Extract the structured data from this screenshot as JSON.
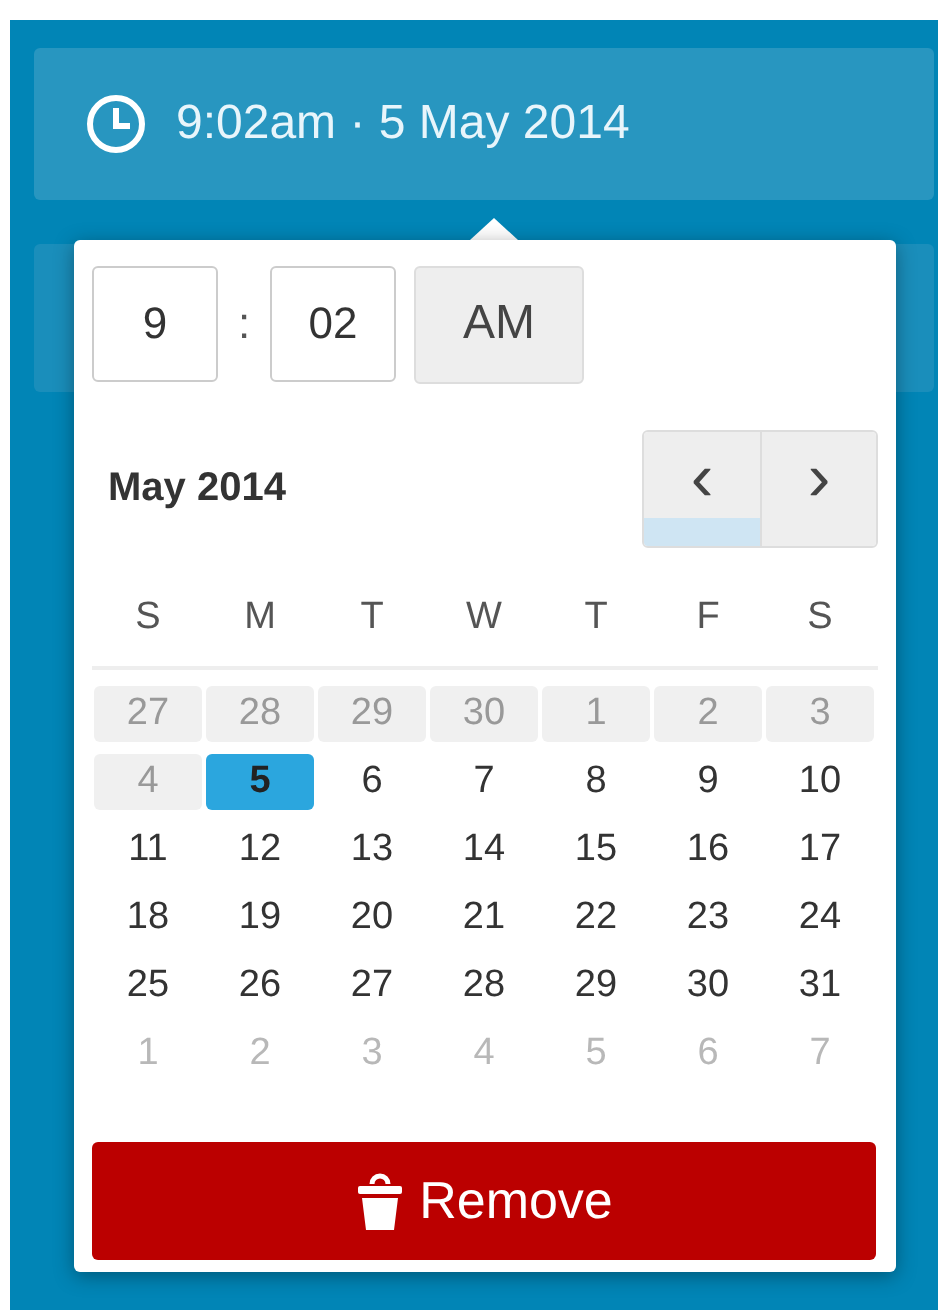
{
  "summary": {
    "text": "9:02am · 5 May 2014"
  },
  "time": {
    "hour": "9",
    "separator": ":",
    "minute": "02",
    "meridiem": "AM"
  },
  "calendar": {
    "title": "May 2014",
    "prev": {
      "label": "‹",
      "focused": true
    },
    "next": {
      "label": "›",
      "focused": false
    },
    "weekdays": [
      "S",
      "M",
      "T",
      "W",
      "T",
      "F",
      "S"
    ],
    "weeks": [
      [
        {
          "label": "27",
          "kind": "disabled",
          "selected": false
        },
        {
          "label": "28",
          "kind": "disabled",
          "selected": false
        },
        {
          "label": "29",
          "kind": "disabled",
          "selected": false
        },
        {
          "label": "30",
          "kind": "disabled",
          "selected": false
        },
        {
          "label": "1",
          "kind": "disabled",
          "selected": false
        },
        {
          "label": "2",
          "kind": "disabled",
          "selected": false
        },
        {
          "label": "3",
          "kind": "disabled",
          "selected": false
        }
      ],
      [
        {
          "label": "4",
          "kind": "disabled",
          "selected": false
        },
        {
          "label": "5",
          "kind": "day",
          "selected": true
        },
        {
          "label": "6",
          "kind": "day",
          "selected": false
        },
        {
          "label": "7",
          "kind": "day",
          "selected": false
        },
        {
          "label": "8",
          "kind": "day",
          "selected": false
        },
        {
          "label": "9",
          "kind": "day",
          "selected": false
        },
        {
          "label": "10",
          "kind": "day",
          "selected": false
        }
      ],
      [
        {
          "label": "11",
          "kind": "day",
          "selected": false
        },
        {
          "label": "12",
          "kind": "day",
          "selected": false
        },
        {
          "label": "13",
          "kind": "day",
          "selected": false
        },
        {
          "label": "14",
          "kind": "day",
          "selected": false
        },
        {
          "label": "15",
          "kind": "day",
          "selected": false
        },
        {
          "label": "16",
          "kind": "day",
          "selected": false
        },
        {
          "label": "17",
          "kind": "day",
          "selected": false
        }
      ],
      [
        {
          "label": "18",
          "kind": "day",
          "selected": false
        },
        {
          "label": "19",
          "kind": "day",
          "selected": false
        },
        {
          "label": "20",
          "kind": "day",
          "selected": false
        },
        {
          "label": "21",
          "kind": "day",
          "selected": false
        },
        {
          "label": "22",
          "kind": "day",
          "selected": false
        },
        {
          "label": "23",
          "kind": "day",
          "selected": false
        },
        {
          "label": "24",
          "kind": "day",
          "selected": false
        }
      ],
      [
        {
          "label": "25",
          "kind": "day",
          "selected": false
        },
        {
          "label": "26",
          "kind": "day",
          "selected": false
        },
        {
          "label": "27",
          "kind": "day",
          "selected": false
        },
        {
          "label": "28",
          "kind": "day",
          "selected": false
        },
        {
          "label": "29",
          "kind": "day",
          "selected": false
        },
        {
          "label": "30",
          "kind": "day",
          "selected": false
        },
        {
          "label": "31",
          "kind": "day",
          "selected": false
        }
      ],
      [
        {
          "label": "1",
          "kind": "next_month",
          "selected": false
        },
        {
          "label": "2",
          "kind": "next_month",
          "selected": false
        },
        {
          "label": "3",
          "kind": "next_month",
          "selected": false
        },
        {
          "label": "4",
          "kind": "next_month",
          "selected": false
        },
        {
          "label": "5",
          "kind": "next_month",
          "selected": false
        },
        {
          "label": "6",
          "kind": "next_month",
          "selected": false
        },
        {
          "label": "7",
          "kind": "next_month",
          "selected": false
        }
      ]
    ]
  },
  "remove_button": {
    "label": "Remove"
  }
}
